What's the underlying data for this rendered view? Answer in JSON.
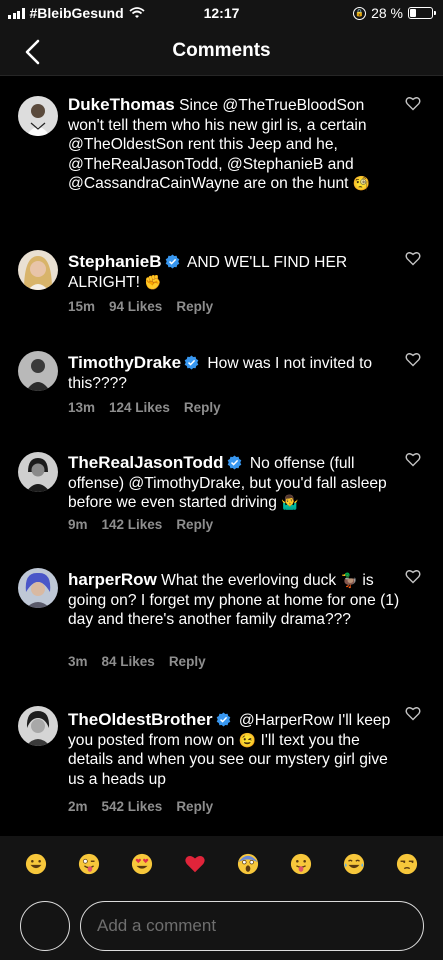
{
  "status_bar": {
    "carrier": "#BleibGesund",
    "time": "12:17",
    "battery": "28 %",
    "battery_level": 0.28
  },
  "header": {
    "title": "Comments"
  },
  "comments": [
    {
      "username": "DukeThomas",
      "text": "Since @TheTrueBloodSon won't tell them who his new girl is, a certain @TheOldestSon rent this Jeep and he, @TheRealJasonTodd, @StephanieB and @CassandraCainWayne are on the hunt",
      "emoji": "🧐",
      "verified": false
    },
    {
      "username": "StephanieB",
      "text": "AND WE'LL FIND HER ALRIGHT!",
      "emoji": "✊",
      "verified": true,
      "time": "15m",
      "likes": "94 Likes",
      "reply": "Reply"
    },
    {
      "username": "TimothyDrake",
      "text": "How was I not invited to this????",
      "emoji": "",
      "verified": true,
      "time": "13m",
      "likes": "124 Likes",
      "reply": "Reply"
    },
    {
      "username": "TheRealJasonTodd",
      "text": "No offense (full offense) @TimothyDrake, but you'd fall asleep before we even started driving",
      "emoji": "🤷‍♂️",
      "verified": true,
      "time": "9m",
      "likes": "142 Likes",
      "reply": "Reply"
    },
    {
      "username": "harperRow",
      "text_a": "What the everloving duck",
      "emoji": "🦆",
      "text_b": "is going on? I forget my phone at home for one (1) day and there's another family drama???",
      "verified": false,
      "time": "3m",
      "likes": "84 Likes",
      "reply": "Reply"
    },
    {
      "username": "TheOldestBrother",
      "text_a": "@HarperRow I'll keep you posted from now on",
      "emoji": "😉",
      "text_b": "I'll text you the details and when you see our mystery girl give us a heads up",
      "verified": true,
      "time": "2m",
      "likes": "542 Likes",
      "reply": "Reply"
    }
  ],
  "emoji_bar": [
    "😀",
    "😜",
    "😍",
    "❤️",
    "😱",
    "😛",
    "😂",
    "😒"
  ],
  "compose": {
    "placeholder": "Add a comment"
  },
  "colors": {
    "background": "#000000",
    "bar": "#141414",
    "meta_text": "#8e8e8e",
    "verified": "#3897f0",
    "heart": "#c4c4c4"
  }
}
